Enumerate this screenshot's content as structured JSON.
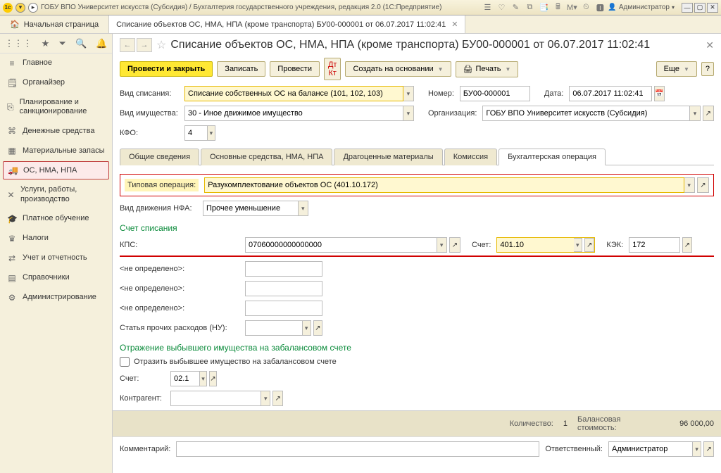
{
  "titlebar": {
    "title": "ГОБУ ВПО Университет искусств (Субсидия) / Бухгалтерия государственного учреждения, редакция 2.0   (1С:Предприятие)",
    "user": "Администратор"
  },
  "tabs": {
    "home": "Начальная страница",
    "doc": "Списание объектов ОС, НМА, НПА (кроме транспорта) БУ00-000001 от 06.07.2017 11:02:41"
  },
  "sidebar": {
    "items": [
      {
        "icon": "≡",
        "label": "Главное"
      },
      {
        "icon": "🗒",
        "label": "Органайзер"
      },
      {
        "icon": "⎘",
        "label": "Планирование и санкционирование"
      },
      {
        "icon": "⌘",
        "label": "Денежные средства"
      },
      {
        "icon": "▦",
        "label": "Материальные запасы"
      },
      {
        "icon": "🚚",
        "label": "ОС, НМА, НПА"
      },
      {
        "icon": "✕",
        "label": "Услуги, работы, производство"
      },
      {
        "icon": "🎓",
        "label": "Платное обучение"
      },
      {
        "icon": "♛",
        "label": "Налоги"
      },
      {
        "icon": "⇄",
        "label": "Учет и отчетность"
      },
      {
        "icon": "▤",
        "label": "Справочники"
      },
      {
        "icon": "⚙",
        "label": "Администрирование"
      }
    ]
  },
  "doc": {
    "title": "Списание объектов ОС, НМА, НПА (кроме транспорта) БУ00-000001 от 06.07.2017 11:02:41",
    "toolbar": {
      "post_close": "Провести и закрыть",
      "save": "Записать",
      "post": "Провести",
      "create_based": "Создать на основании",
      "print": "Печать",
      "more": "Еще"
    },
    "fields": {
      "vid_spisania_lbl": "Вид списания:",
      "vid_spisania": "Списание собственных ОС на балансе (101, 102, 103)",
      "nomer_lbl": "Номер:",
      "nomer": "БУ00-000001",
      "data_lbl": "Дата:",
      "data": "06.07.2017 11:02:41",
      "vid_imu_lbl": "Вид имущества:",
      "vid_imu": "30 - Иное движимое имущество",
      "org_lbl": "Организация:",
      "org": "ГОБУ ВПО Университет искусств (Субсидия)",
      "kfo_lbl": "КФО:",
      "kfo": "4"
    },
    "doctabs": [
      "Общие сведения",
      "Основные средства, НМА, НПА",
      "Драгоценные материалы",
      "Комиссия",
      "Бухгалтерская операция"
    ],
    "active_tab": 4,
    "typ_op_lbl": "Типовая операция:",
    "typ_op": "Разукомплектование объектов ОС (401.10.172)",
    "vid_dvij_lbl": "Вид движения НФА:",
    "vid_dvij": "Прочее уменьшение",
    "sect_writeoff": "Счет списания",
    "kps_lbl": "КПС:",
    "kps": "07060000000000000",
    "schet_lbl": "Счет:",
    "schet": "401.10",
    "kek_lbl": "КЭК:",
    "kek": "172",
    "undef": "<не определено>:",
    "stat_lbl": "Статья прочих расходов (НУ):",
    "sect_offbal": "Отражение выбывшего имущества на забалансовом счете",
    "chk_offbal": "Отразить выбывшее имущество на забалансовом счете",
    "schet2_lbl": "Счет:",
    "schet2": "02.1",
    "kontr_lbl": "Контрагент:",
    "totals": {
      "qty_lbl": "Количество:",
      "qty": "1",
      "bal_lbl": "Балансовая стоимость:",
      "bal": "96 000,00"
    },
    "footer": {
      "comment_lbl": "Комментарий:",
      "resp_lbl": "Ответственный:",
      "resp": "Администратор"
    }
  }
}
